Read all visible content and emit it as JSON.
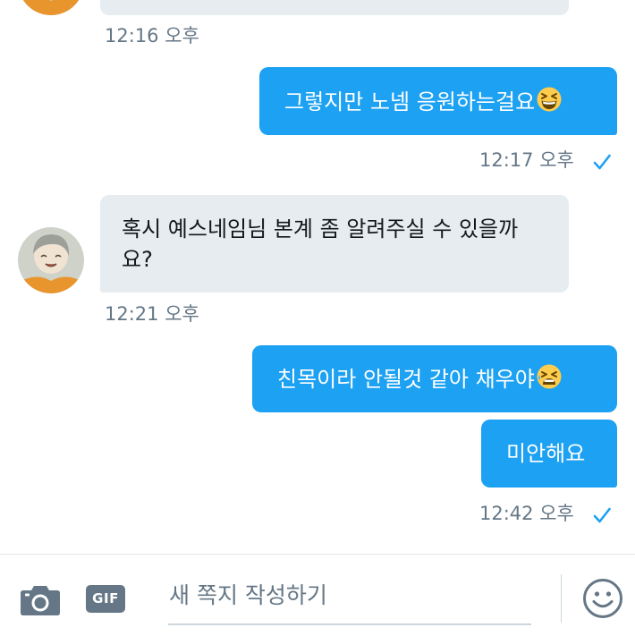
{
  "messages": [
    {
      "direction": "in",
      "text": "",
      "time": "12:16 오후"
    },
    {
      "direction": "out",
      "text": "그렇지만 노넴 응원하는걸요",
      "emoji": "grinning-squinting-face",
      "time": "12:17 오후",
      "read": true
    },
    {
      "direction": "in",
      "text": "혹시 예스네임님 본계 좀 알려주실 수 있을까요?",
      "time": "12:21 오후"
    },
    {
      "direction": "out",
      "text": "친목이라 안될것 같아 채우야",
      "emoji": "tired-face"
    },
    {
      "direction": "out",
      "text": "미안해요",
      "time": "12:42 오후",
      "read": true
    }
  ],
  "composer": {
    "placeholder": "새 쪽지 작성하기",
    "camera_icon": "camera-icon",
    "gif_label": "GIF",
    "emoji_icon": "smiley-icon"
  },
  "colors": {
    "outgoing_bubble": "#1da1f2",
    "incoming_bubble": "#e6ecf0",
    "timestamp": "#657786",
    "read_check": "#1da1f2"
  }
}
